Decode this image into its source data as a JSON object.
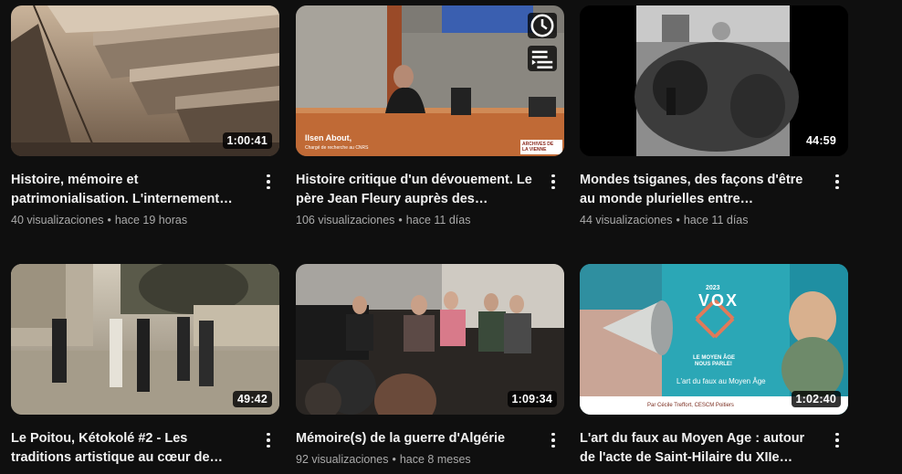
{
  "videos": [
    {
      "title": "Histoire, mémoire et patrimonialisation. L'internement des…",
      "views": "40 visualizaciones",
      "age": "hace 19 horas",
      "duration": "1:00:41"
    },
    {
      "title": "Histoire critique d'un dévouement. Le père Jean Fleury auprès des Nomade…",
      "views": "106 visualizaciones",
      "age": "hace 11 días",
      "duration": "",
      "overlay_name": "Ilsen About,",
      "overlay_role": "Chargé de recherche au CNRS",
      "overlay_logo": "ARCHIVES DE LA VIENNE"
    },
    {
      "title": "Mondes tsiganes, des façons d'être au monde plurielles entre circulations et…",
      "views": "44 visualizaciones",
      "age": "hace 11 días",
      "duration": "44:59"
    },
    {
      "title": "Le Poitou, Kétokolé #2 - Les traditions artistique au cœur de l'identité…",
      "views": "",
      "age": "",
      "duration": "49:42"
    },
    {
      "title": "Mémoire(s) de la guerre d'Algérie",
      "views": "92 visualizaciones",
      "age": "hace 8 meses",
      "duration": "1:09:34"
    },
    {
      "title": "L'art du faux au Moyen Age : autour de l'acte de Saint-Hilaire du XIIe siècle…",
      "views": "",
      "age": "",
      "duration": "1:02:40",
      "poster_year": "2023",
      "poster_brand": "VOX",
      "poster_tagline_1": "LE MOYEN ÂGE",
      "poster_tagline_2": "NOUS PARLE!",
      "poster_subtitle": "L'art du faux au Moyen Âge",
      "poster_author": "Par Cécile Treffort, CESCM Poitiers"
    }
  ]
}
